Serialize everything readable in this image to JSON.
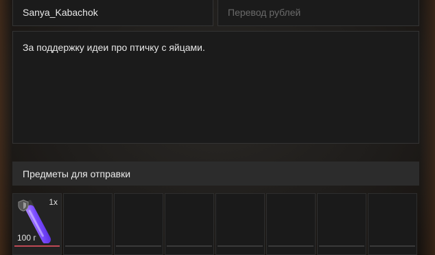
{
  "form": {
    "nickname_value": "Sanya_Kabachok",
    "amount_placeholder": "Перевод рублей",
    "message_value": "За поддержку идеи про птичку с яйцами."
  },
  "items_section": {
    "title": "Предметы для отправки",
    "slots": [
      {
        "filled": true,
        "icon": "glowstick-icon",
        "badge_icon": "shield-icon",
        "quantity": "1x",
        "weight": "100 г"
      },
      {
        "filled": false
      },
      {
        "filled": false
      },
      {
        "filled": false
      },
      {
        "filled": false
      },
      {
        "filled": false
      },
      {
        "filled": false
      },
      {
        "filled": false
      }
    ]
  },
  "colors": {
    "slot_selected_bar": "#c04a55",
    "glowstick": "#8a5cff"
  }
}
